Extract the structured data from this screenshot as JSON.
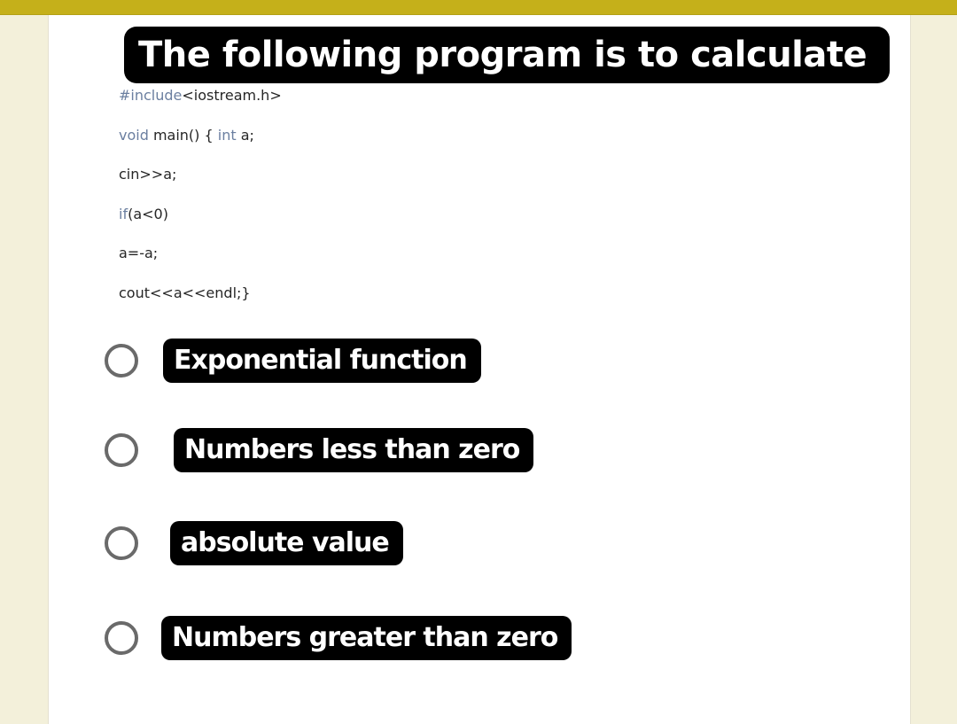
{
  "question": {
    "title": "The following program is to calculate",
    "code_lines": [
      {
        "keyword": "#include",
        "rest": "<iostream.h>"
      },
      {
        "keyword": "void",
        "rest": " main() { ",
        "keyword2": "int",
        "rest2": " a;"
      },
      {
        "keyword": "",
        "rest": "cin>>a;"
      },
      {
        "keyword": "if",
        "rest": "(a<0)"
      },
      {
        "keyword": "",
        "rest": "a=-a;"
      },
      {
        "keyword": "",
        "rest": "cout<<a<<endl;}"
      }
    ]
  },
  "options": [
    {
      "label": "Exponential function",
      "selected": false,
      "radio_icon": "radio-unchecked-icon"
    },
    {
      "label": "Numbers less than zero",
      "selected": false,
      "radio_icon": "radio-unchecked-icon"
    },
    {
      "label": "absolute value",
      "selected": false,
      "radio_icon": "radio-unchecked-icon"
    },
    {
      "label": "Numbers greater than zero",
      "selected": false,
      "radio_icon": "radio-unchecked-icon"
    }
  ],
  "colors": {
    "top_bar": "#c5b01a",
    "background": "#f3f0da",
    "card": "#ffffff",
    "keyword": "#6b7fa0",
    "radio_border": "#6a6a6a"
  }
}
